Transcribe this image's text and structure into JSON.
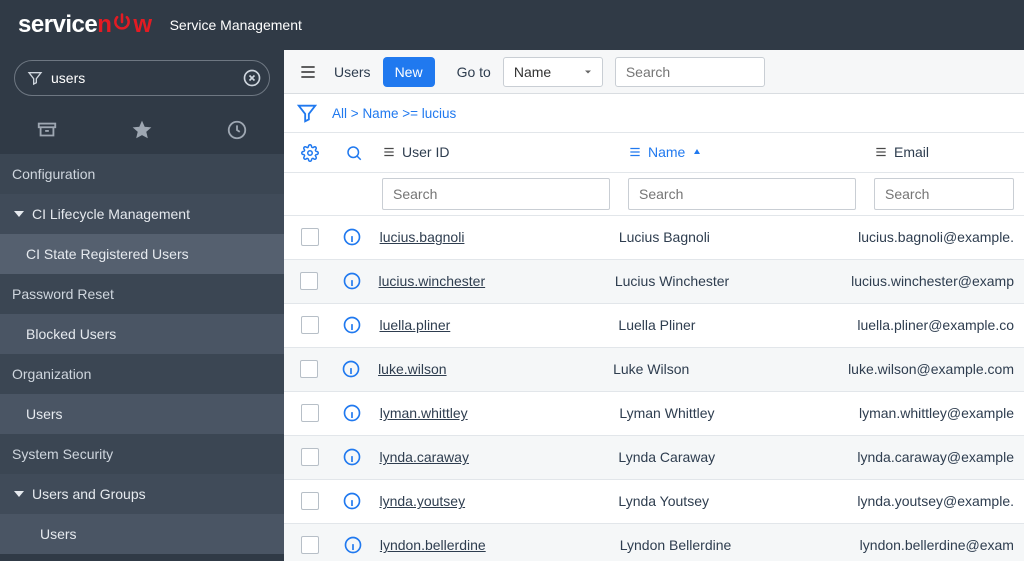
{
  "header": {
    "logo_service": "service",
    "logo_n": "n",
    "logo_w": "w",
    "app_title": "Service Management"
  },
  "nav": {
    "filter_value": "users",
    "sections": {
      "configuration": "Configuration",
      "ci_lifecycle": "CI Lifecycle Management",
      "ci_state_users": "CI State Registered Users",
      "password_reset": "Password Reset",
      "blocked_users": "Blocked Users",
      "organization": "Organization",
      "org_users": "Users",
      "system_security": "System Security",
      "users_and_groups": "Users and Groups",
      "ss_users": "Users"
    }
  },
  "toolbar": {
    "title": "Users",
    "new_label": "New",
    "goto_label": "Go to",
    "goto_field": "Name",
    "search_placeholder": "Search"
  },
  "breadcrumbs": {
    "all": "All",
    "sep": ">",
    "query": "Name >= lucius"
  },
  "columns": {
    "user_id": "User ID",
    "name": "Name",
    "email": "Email",
    "filter_placeholder": "Search"
  },
  "rows": [
    {
      "user_id": "lucius.bagnoli",
      "name": "Lucius Bagnoli",
      "email": "lucius.bagnoli@example."
    },
    {
      "user_id": "lucius.winchester",
      "name": "Lucius Winchester",
      "email": "lucius.winchester@examp"
    },
    {
      "user_id": "luella.pliner",
      "name": "Luella Pliner",
      "email": "luella.pliner@example.co"
    },
    {
      "user_id": "luke.wilson",
      "name": "Luke Wilson",
      "email": "luke.wilson@example.com"
    },
    {
      "user_id": "lyman.whittley",
      "name": "Lyman Whittley",
      "email": "lyman.whittley@example"
    },
    {
      "user_id": "lynda.caraway",
      "name": "Lynda Caraway",
      "email": "lynda.caraway@example"
    },
    {
      "user_id": "lynda.youtsey",
      "name": "Lynda Youtsey",
      "email": "lynda.youtsey@example."
    },
    {
      "user_id": "lyndon.bellerdine",
      "name": "Lyndon Bellerdine",
      "email": "lyndon.bellerdine@exam"
    }
  ]
}
